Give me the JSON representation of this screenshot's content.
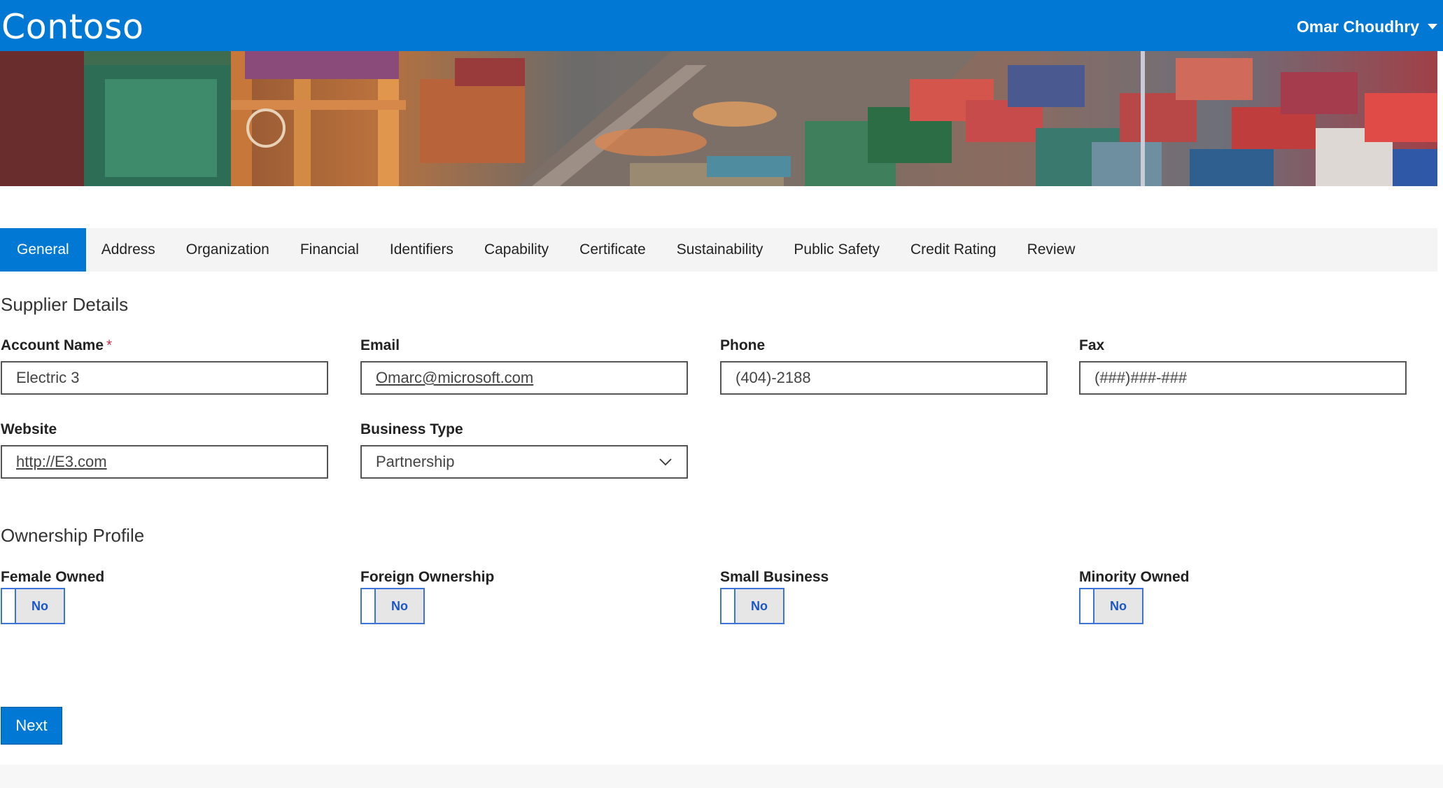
{
  "header": {
    "brand": "Contoso",
    "user_name": "Omar Choudhry"
  },
  "tabs": [
    {
      "label": "General",
      "active": true
    },
    {
      "label": "Address"
    },
    {
      "label": "Organization"
    },
    {
      "label": "Financial"
    },
    {
      "label": "Identifiers"
    },
    {
      "label": "Capability"
    },
    {
      "label": "Certificate"
    },
    {
      "label": "Sustainability"
    },
    {
      "label": "Public Safety"
    },
    {
      "label": "Credit Rating"
    },
    {
      "label": "Review"
    }
  ],
  "supplier_details": {
    "title": "Supplier Details",
    "account_name": {
      "label": "Account Name",
      "required_mark": "*",
      "value": "Electric 3"
    },
    "email": {
      "label": "Email",
      "value": "Omarc@microsoft.com"
    },
    "phone": {
      "label": "Phone",
      "value": "(404)-2188"
    },
    "fax": {
      "label": "Fax",
      "value": "(###)###-###"
    },
    "website": {
      "label": "Website",
      "value": "http://E3.com"
    },
    "business_type": {
      "label": "Business Type",
      "value": "Partnership"
    }
  },
  "ownership_profile": {
    "title": "Ownership Profile",
    "female_owned": {
      "label": "Female Owned",
      "value": "No"
    },
    "foreign_ownership": {
      "label": "Foreign Ownership",
      "value": "No"
    },
    "small_business": {
      "label": "Small Business",
      "value": "No"
    },
    "minority_owned": {
      "label": "Minority Owned",
      "value": "No"
    }
  },
  "actions": {
    "next_label": "Next"
  },
  "colors": {
    "accent": "#0078d4",
    "toggle_border": "#3b73d9"
  }
}
